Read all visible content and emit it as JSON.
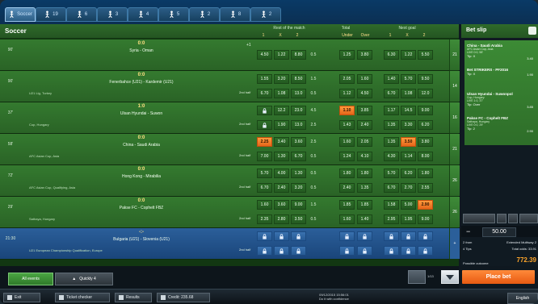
{
  "nav": {
    "sport_tabs": [
      {
        "label": "Soccer",
        "count": "",
        "icon": "soccer-player-icon"
      },
      {
        "label": "",
        "count": "19",
        "icon": "tennis-player-icon"
      },
      {
        "label": "",
        "count": "6",
        "icon": "basketball-player-icon"
      },
      {
        "label": "",
        "count": "3",
        "icon": "hockey-player-icon"
      },
      {
        "label": "",
        "count": "4",
        "icon": "volleyball-player-icon"
      },
      {
        "label": "",
        "count": "5",
        "icon": "handball-player-icon"
      },
      {
        "label": "",
        "count": "2",
        "icon": "baseball-player-icon"
      },
      {
        "label": "",
        "count": "8",
        "icon": "american-football-player-icon"
      },
      {
        "label": "",
        "count": "2",
        "icon": "boxing-player-icon"
      }
    ]
  },
  "header": {
    "title": "Soccer",
    "groups": [
      "Rest of the match",
      "Total",
      "Next goal"
    ],
    "subs_rest": [
      "1",
      "X",
      "2"
    ],
    "subs_total": [
      "Under",
      "Over"
    ],
    "subs_next": [
      "1",
      "X",
      "2"
    ]
  },
  "rows": [
    {
      "time": "90'",
      "score": "0:0",
      "teams": "Syria - Oman",
      "league": "",
      "info": "",
      "marker": "+1",
      "line1": {
        "o": [
          "4.50",
          "1.22",
          "8.80"
        ],
        "h": "0.5",
        "t": [
          "1.25",
          "3.80"
        ],
        "n": [
          "6.30",
          "1.22",
          "5.50"
        ],
        "hot": []
      },
      "line2": null,
      "count": "21",
      "live": false
    },
    {
      "time": "90'",
      "score": "0:0",
      "teams": "Fenerbahce (U21) - Kardemir (U21)",
      "league": "U21 Lig, Turkey",
      "info": "2nd half",
      "marker": "",
      "line1": {
        "o": [
          "1.55",
          "3.20",
          "8.50"
        ],
        "h": "1.5",
        "t": [
          "2.05",
          "1.60"
        ],
        "n": [
          "1.40",
          "5.70",
          "9.50"
        ],
        "hot": []
      },
      "line2": {
        "o": [
          "6.70",
          "1.08",
          "13.0"
        ],
        "h": "0.5",
        "t": [
          "1.12",
          "4.50"
        ],
        "n": [
          "6.70",
          "1.08",
          "12.0"
        ],
        "hot": []
      },
      "count": "14",
      "live": false
    },
    {
      "time": "37'",
      "score": "1:0",
      "teams": "Ulsan Hyundai - Suwon",
      "league": "Cup, Hungary",
      "info": "2nd half",
      "marker": "",
      "line1": {
        "o": [
          "lock",
          "12.2",
          "23.0"
        ],
        "h": "4.5",
        "t": [
          "1.10",
          "3.85"
        ],
        "n": [
          "1.17",
          "14.5",
          "9.00"
        ],
        "hot": [
          "t1"
        ]
      },
      "line2": {
        "o": [
          "lock",
          "1.90",
          "13.0"
        ],
        "h": "2.5",
        "t": [
          "1.43",
          "2.40"
        ],
        "n": [
          "1.35",
          "3.30",
          "6.20"
        ],
        "hot": []
      },
      "count": "16",
      "live": false
    },
    {
      "time": "58'",
      "score": "0:0",
      "teams": "China - Saudi Arabia",
      "league": "AFC Asian Cup, Asia",
      "info": "2nd half",
      "marker": "",
      "line1": {
        "o": [
          "2.25",
          "3.40",
          "3.60"
        ],
        "h": "2.5",
        "t": [
          "1.60",
          "2.05"
        ],
        "n": [
          "1.35",
          "3.50",
          "3.80"
        ],
        "hot": [
          "o1",
          "n2"
        ]
      },
      "line2": {
        "o": [
          "7.00",
          "1.30",
          "6.70"
        ],
        "h": "0.5",
        "t": [
          "1.24",
          "4.10"
        ],
        "n": [
          "4.30",
          "1.14",
          "8.00"
        ],
        "hot": []
      },
      "count": "21",
      "live": false
    },
    {
      "time": "72'",
      "score": "0:0",
      "teams": "Hong Kong - Mirabilia",
      "league": "AFC Asian Cup, Qualifying, Asia",
      "info": "2nd half",
      "marker": "",
      "line1": {
        "o": [
          "5.70",
          "4.00",
          "1.30"
        ],
        "h": "0.5",
        "t": [
          "1.80",
          "1.80"
        ],
        "n": [
          "5.70",
          "6.20",
          "1.80"
        ],
        "hot": []
      },
      "line2": {
        "o": [
          "6.70",
          "2.40",
          "3.20"
        ],
        "h": "0.5",
        "t": [
          "2.40",
          "1.35"
        ],
        "n": [
          "6.70",
          "2.70",
          "2.55"
        ],
        "hot": []
      },
      "count": "26",
      "live": false
    },
    {
      "time": "29'",
      "score": "0:0",
      "teams": "Pakse FC - Cophelt FBZ",
      "league": "Sathaya, Hungary",
      "info": "2nd half",
      "marker": "",
      "line1": {
        "o": [
          "1.60",
          "3.60",
          "9.00"
        ],
        "h": "1.5",
        "t": [
          "1.85",
          "1.85"
        ],
        "n": [
          "1.58",
          "5.00",
          "2.90"
        ],
        "hot": [
          "n3"
        ]
      },
      "line2": {
        "o": [
          "2.35",
          "2.80",
          "3.50"
        ],
        "h": "0.5",
        "t": [
          "1.60",
          "1.40"
        ],
        "n": [
          "2.95",
          "1.95",
          "9.00"
        ],
        "hot": []
      },
      "count": "26",
      "live": false
    },
    {
      "time": "21:30",
      "score": "-:-",
      "teams": "Bulgaria (U21) - Slovenia (U21)",
      "league": "U21 European Championship Qualification, Europe",
      "info": "2nd half",
      "marker": "",
      "line1": {
        "o": [
          "lock",
          "lock",
          "lock"
        ],
        "h": "",
        "t": [
          "lock",
          "lock"
        ],
        "n": [
          "lock",
          "lock",
          "lock"
        ],
        "hot": []
      },
      "line2": {
        "o": [
          "lock",
          "lock",
          "lock"
        ],
        "h": "",
        "t": [
          "lock",
          "lock"
        ],
        "n": [
          "lock",
          "lock",
          "lock"
        ],
        "hot": []
      },
      "count": "+",
      "live": true
    }
  ],
  "filters": {
    "all_events": "All events",
    "quickly": "Quickly 4",
    "pager": "1/13"
  },
  "betslip": {
    "title": "Bet slip",
    "items": [
      {
        "match": "China - Saudi Arabia",
        "sub1": "AFC Asian Cup, Asia",
        "sub2": "LIVE 0:0, 58'",
        "tip": "Tip: X",
        "odd": "3.40"
      },
      {
        "match": "Bet STRIKERS - PF2016",
        "sub1": "",
        "sub2": "",
        "tip": "Tip: X",
        "odd": "1.90"
      },
      {
        "match": "Ulsan Hyundai - Suwonpol",
        "sub1": "Cup, Hungary",
        "sub2": "LIVE 1:0, 37'",
        "tip": "Tip: Over",
        "odd": "3.85"
      },
      {
        "match": "Pakse FC - Cophelt FBZ",
        "sub1": "Sathaya, Hungary",
        "sub2": "LIVE 0:0, 29'",
        "tip": "Tip: 2",
        "odd": "2.90"
      }
    ],
    "stake": "50.00",
    "summary": [
      {
        "l": "2 from",
        "r": "Extended Multiway 2"
      },
      {
        "l": "4 Tips",
        "r": "Total odds: 33.91"
      },
      {
        "l": "Possible outcome",
        "r": ""
      }
    ],
    "possible_win": "772.39",
    "place_bet": "Place bet"
  },
  "bottom": {
    "exit": "Exit",
    "ticket_checker": "Ticket checker",
    "results": "Results",
    "credit": "Credit: 235.68",
    "clock_line1": "09/12/2015 15:56:01",
    "clock_line2": "Do it with confidence",
    "lang": "English"
  },
  "colors": {
    "green": "#2f6b2a",
    "orange": "#e4661a",
    "live_blue": "#2b5f9a"
  }
}
